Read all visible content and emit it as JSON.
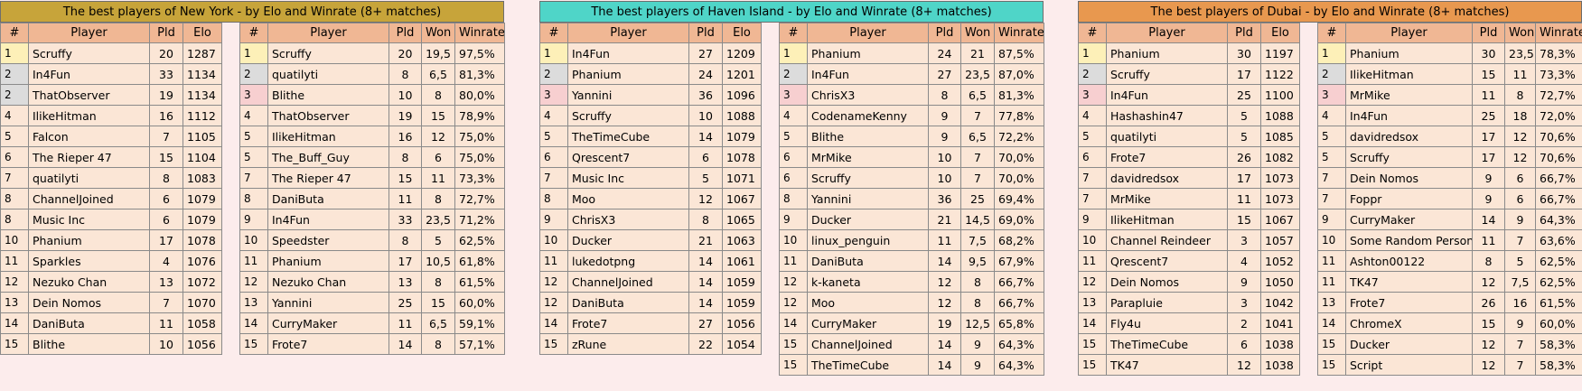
{
  "colors": {
    "title_ny": "#c7a43a",
    "title_haven": "#4fd5c8",
    "title_dubai": "#e8984f",
    "header": "#f0b794",
    "cell": "#fbe6d6",
    "gold": "#fdf0b8",
    "silver": "#dcdcdc",
    "bronze": "#f7cfd0"
  },
  "sections": [
    {
      "id": "ny",
      "title": "The best players of New York - by Elo and Winrate (8+ matches)",
      "elo_table": {
        "headers": [
          "#",
          "Player",
          "Pld",
          "Elo"
        ],
        "rows": [
          [
            "1",
            "Scruffy",
            "20",
            "1287"
          ],
          [
            "2",
            "In4Fun",
            "33",
            "1134"
          ],
          [
            "2",
            "ThatObserver",
            "19",
            "1134"
          ],
          [
            "4",
            "IlikeHitman",
            "16",
            "1112"
          ],
          [
            "5",
            "Falcon",
            "7",
            "1105"
          ],
          [
            "6",
            "The Rieper 47",
            "15",
            "1104"
          ],
          [
            "7",
            "quatilyti",
            "8",
            "1083"
          ],
          [
            "8",
            "ChannelJoined",
            "6",
            "1079"
          ],
          [
            "8",
            "Music Inc",
            "6",
            "1079"
          ],
          [
            "10",
            "Phanium",
            "17",
            "1078"
          ],
          [
            "11",
            "Sparkles",
            "4",
            "1076"
          ],
          [
            "12",
            "Nezuko Chan",
            "13",
            "1072"
          ],
          [
            "13",
            "Dein Nomos",
            "7",
            "1070"
          ],
          [
            "14",
            "DaniButa",
            "11",
            "1058"
          ],
          [
            "15",
            "Blithe",
            "10",
            "1056"
          ]
        ]
      },
      "winrate_table": {
        "headers": [
          "#",
          "Player",
          "Pld",
          "Won",
          "Winrate"
        ],
        "rows": [
          [
            "1",
            "Scruffy",
            "20",
            "19,5",
            "97,5%"
          ],
          [
            "2",
            "quatilyti",
            "8",
            "6,5",
            "81,3%"
          ],
          [
            "3",
            "Blithe",
            "10",
            "8",
            "80,0%"
          ],
          [
            "4",
            "ThatObserver",
            "19",
            "15",
            "78,9%"
          ],
          [
            "5",
            "IlikeHitman",
            "16",
            "12",
            "75,0%"
          ],
          [
            "5",
            "The_Buff_Guy",
            "8",
            "6",
            "75,0%"
          ],
          [
            "7",
            "The Rieper 47",
            "15",
            "11",
            "73,3%"
          ],
          [
            "8",
            "DaniButa",
            "11",
            "8",
            "72,7%"
          ],
          [
            "9",
            "In4Fun",
            "33",
            "23,5",
            "71,2%"
          ],
          [
            "10",
            "Speedster",
            "8",
            "5",
            "62,5%"
          ],
          [
            "11",
            "Phanium",
            "17",
            "10,5",
            "61,8%"
          ],
          [
            "12",
            "Nezuko Chan",
            "13",
            "8",
            "61,5%"
          ],
          [
            "13",
            "Yannini",
            "25",
            "15",
            "60,0%"
          ],
          [
            "14",
            "CurryMaker",
            "11",
            "6,5",
            "59,1%"
          ],
          [
            "15",
            "Frote7",
            "14",
            "8",
            "57,1%"
          ]
        ]
      }
    },
    {
      "id": "haven",
      "title": "The best players of Haven Island - by Elo and Winrate (8+ matches)",
      "elo_table": {
        "headers": [
          "#",
          "Player",
          "Pld",
          "Elo"
        ],
        "rows": [
          [
            "1",
            "In4Fun",
            "27",
            "1209"
          ],
          [
            "2",
            "Phanium",
            "24",
            "1201"
          ],
          [
            "3",
            "Yannini",
            "36",
            "1096"
          ],
          [
            "4",
            "Scruffy",
            "10",
            "1088"
          ],
          [
            "5",
            "TheTimeCube",
            "14",
            "1079"
          ],
          [
            "6",
            "Qrescent7",
            "6",
            "1078"
          ],
          [
            "7",
            "Music Inc",
            "5",
            "1071"
          ],
          [
            "8",
            "Moo",
            "12",
            "1067"
          ],
          [
            "9",
            "ChrisX3",
            "8",
            "1065"
          ],
          [
            "10",
            "Ducker",
            "21",
            "1063"
          ],
          [
            "11",
            "lukedotpng",
            "14",
            "1061"
          ],
          [
            "12",
            "ChannelJoined",
            "14",
            "1059"
          ],
          [
            "12",
            "DaniButa",
            "14",
            "1059"
          ],
          [
            "14",
            "Frote7",
            "27",
            "1056"
          ],
          [
            "15",
            "zRune",
            "22",
            "1054"
          ]
        ]
      },
      "winrate_table": {
        "headers": [
          "#",
          "Player",
          "Pld",
          "Won",
          "Winrate"
        ],
        "rows": [
          [
            "1",
            "Phanium",
            "24",
            "21",
            "87,5%"
          ],
          [
            "2",
            "In4Fun",
            "27",
            "23,5",
            "87,0%"
          ],
          [
            "3",
            "ChrisX3",
            "8",
            "6,5",
            "81,3%"
          ],
          [
            "4",
            "CodenameKenny",
            "9",
            "7",
            "77,8%"
          ],
          [
            "5",
            "Blithe",
            "9",
            "6,5",
            "72,2%"
          ],
          [
            "6",
            "MrMike",
            "10",
            "7",
            "70,0%"
          ],
          [
            "6",
            "Scruffy",
            "10",
            "7",
            "70,0%"
          ],
          [
            "8",
            "Yannini",
            "36",
            "25",
            "69,4%"
          ],
          [
            "9",
            "Ducker",
            "21",
            "14,5",
            "69,0%"
          ],
          [
            "10",
            "linux_penguin",
            "11",
            "7,5",
            "68,2%"
          ],
          [
            "11",
            "DaniButa",
            "14",
            "9,5",
            "67,9%"
          ],
          [
            "12",
            "k-kaneta",
            "12",
            "8",
            "66,7%"
          ],
          [
            "12",
            "Moo",
            "12",
            "8",
            "66,7%"
          ],
          [
            "14",
            "CurryMaker",
            "19",
            "12,5",
            "65,8%"
          ],
          [
            "15",
            "ChannelJoined",
            "14",
            "9",
            "64,3%"
          ],
          [
            "15",
            "TheTimeCube",
            "14",
            "9",
            "64,3%"
          ]
        ]
      }
    },
    {
      "id": "dubai",
      "title": "The best players of Dubai - by Elo and Winrate (8+ matches)",
      "elo_table": {
        "headers": [
          "#",
          "Player",
          "Pld",
          "Elo"
        ],
        "rows": [
          [
            "1",
            "Phanium",
            "30",
            "1197"
          ],
          [
            "2",
            "Scruffy",
            "17",
            "1122"
          ],
          [
            "3",
            "In4Fun",
            "25",
            "1100"
          ],
          [
            "4",
            "Hashashin47",
            "5",
            "1088"
          ],
          [
            "5",
            "quatilyti",
            "5",
            "1085"
          ],
          [
            "6",
            "Frote7",
            "26",
            "1082"
          ],
          [
            "7",
            "davidredsox",
            "17",
            "1073"
          ],
          [
            "7",
            "MrMike",
            "11",
            "1073"
          ],
          [
            "9",
            "IlikeHitman",
            "15",
            "1067"
          ],
          [
            "10",
            "Channel Reindeer",
            "3",
            "1057"
          ],
          [
            "11",
            "Qrescent7",
            "4",
            "1052"
          ],
          [
            "12",
            "Dein Nomos",
            "9",
            "1050"
          ],
          [
            "13",
            "Parapluie",
            "3",
            "1042"
          ],
          [
            "14",
            "Fly4u",
            "2",
            "1041"
          ],
          [
            "15",
            "TheTimeCube",
            "6",
            "1038"
          ],
          [
            "15",
            "TK47",
            "12",
            "1038"
          ]
        ]
      },
      "winrate_table": {
        "headers": [
          "#",
          "Player",
          "Pld",
          "Won",
          "Winrate"
        ],
        "rows": [
          [
            "1",
            "Phanium",
            "30",
            "23,5",
            "78,3%"
          ],
          [
            "2",
            "IlikeHitman",
            "15",
            "11",
            "73,3%"
          ],
          [
            "3",
            "MrMike",
            "11",
            "8",
            "72,7%"
          ],
          [
            "4",
            "In4Fun",
            "25",
            "18",
            "72,0%"
          ],
          [
            "5",
            "davidredsox",
            "17",
            "12",
            "70,6%"
          ],
          [
            "5",
            "Scruffy",
            "17",
            "12",
            "70,6%"
          ],
          [
            "7",
            "Dein Nomos",
            "9",
            "6",
            "66,7%"
          ],
          [
            "7",
            "Foppr",
            "9",
            "6",
            "66,7%"
          ],
          [
            "9",
            "CurryMaker",
            "14",
            "9",
            "64,3%"
          ],
          [
            "10",
            "Some Random Person",
            "11",
            "7",
            "63,6%"
          ],
          [
            "11",
            "Ashton00122",
            "8",
            "5",
            "62,5%"
          ],
          [
            "11",
            "TK47",
            "12",
            "7,5",
            "62,5%"
          ],
          [
            "13",
            "Frote7",
            "26",
            "16",
            "61,5%"
          ],
          [
            "14",
            "ChromeX",
            "15",
            "9",
            "60,0%"
          ],
          [
            "15",
            "Ducker",
            "12",
            "7",
            "58,3%"
          ],
          [
            "15",
            "Script",
            "12",
            "7",
            "58,3%"
          ]
        ]
      }
    }
  ]
}
